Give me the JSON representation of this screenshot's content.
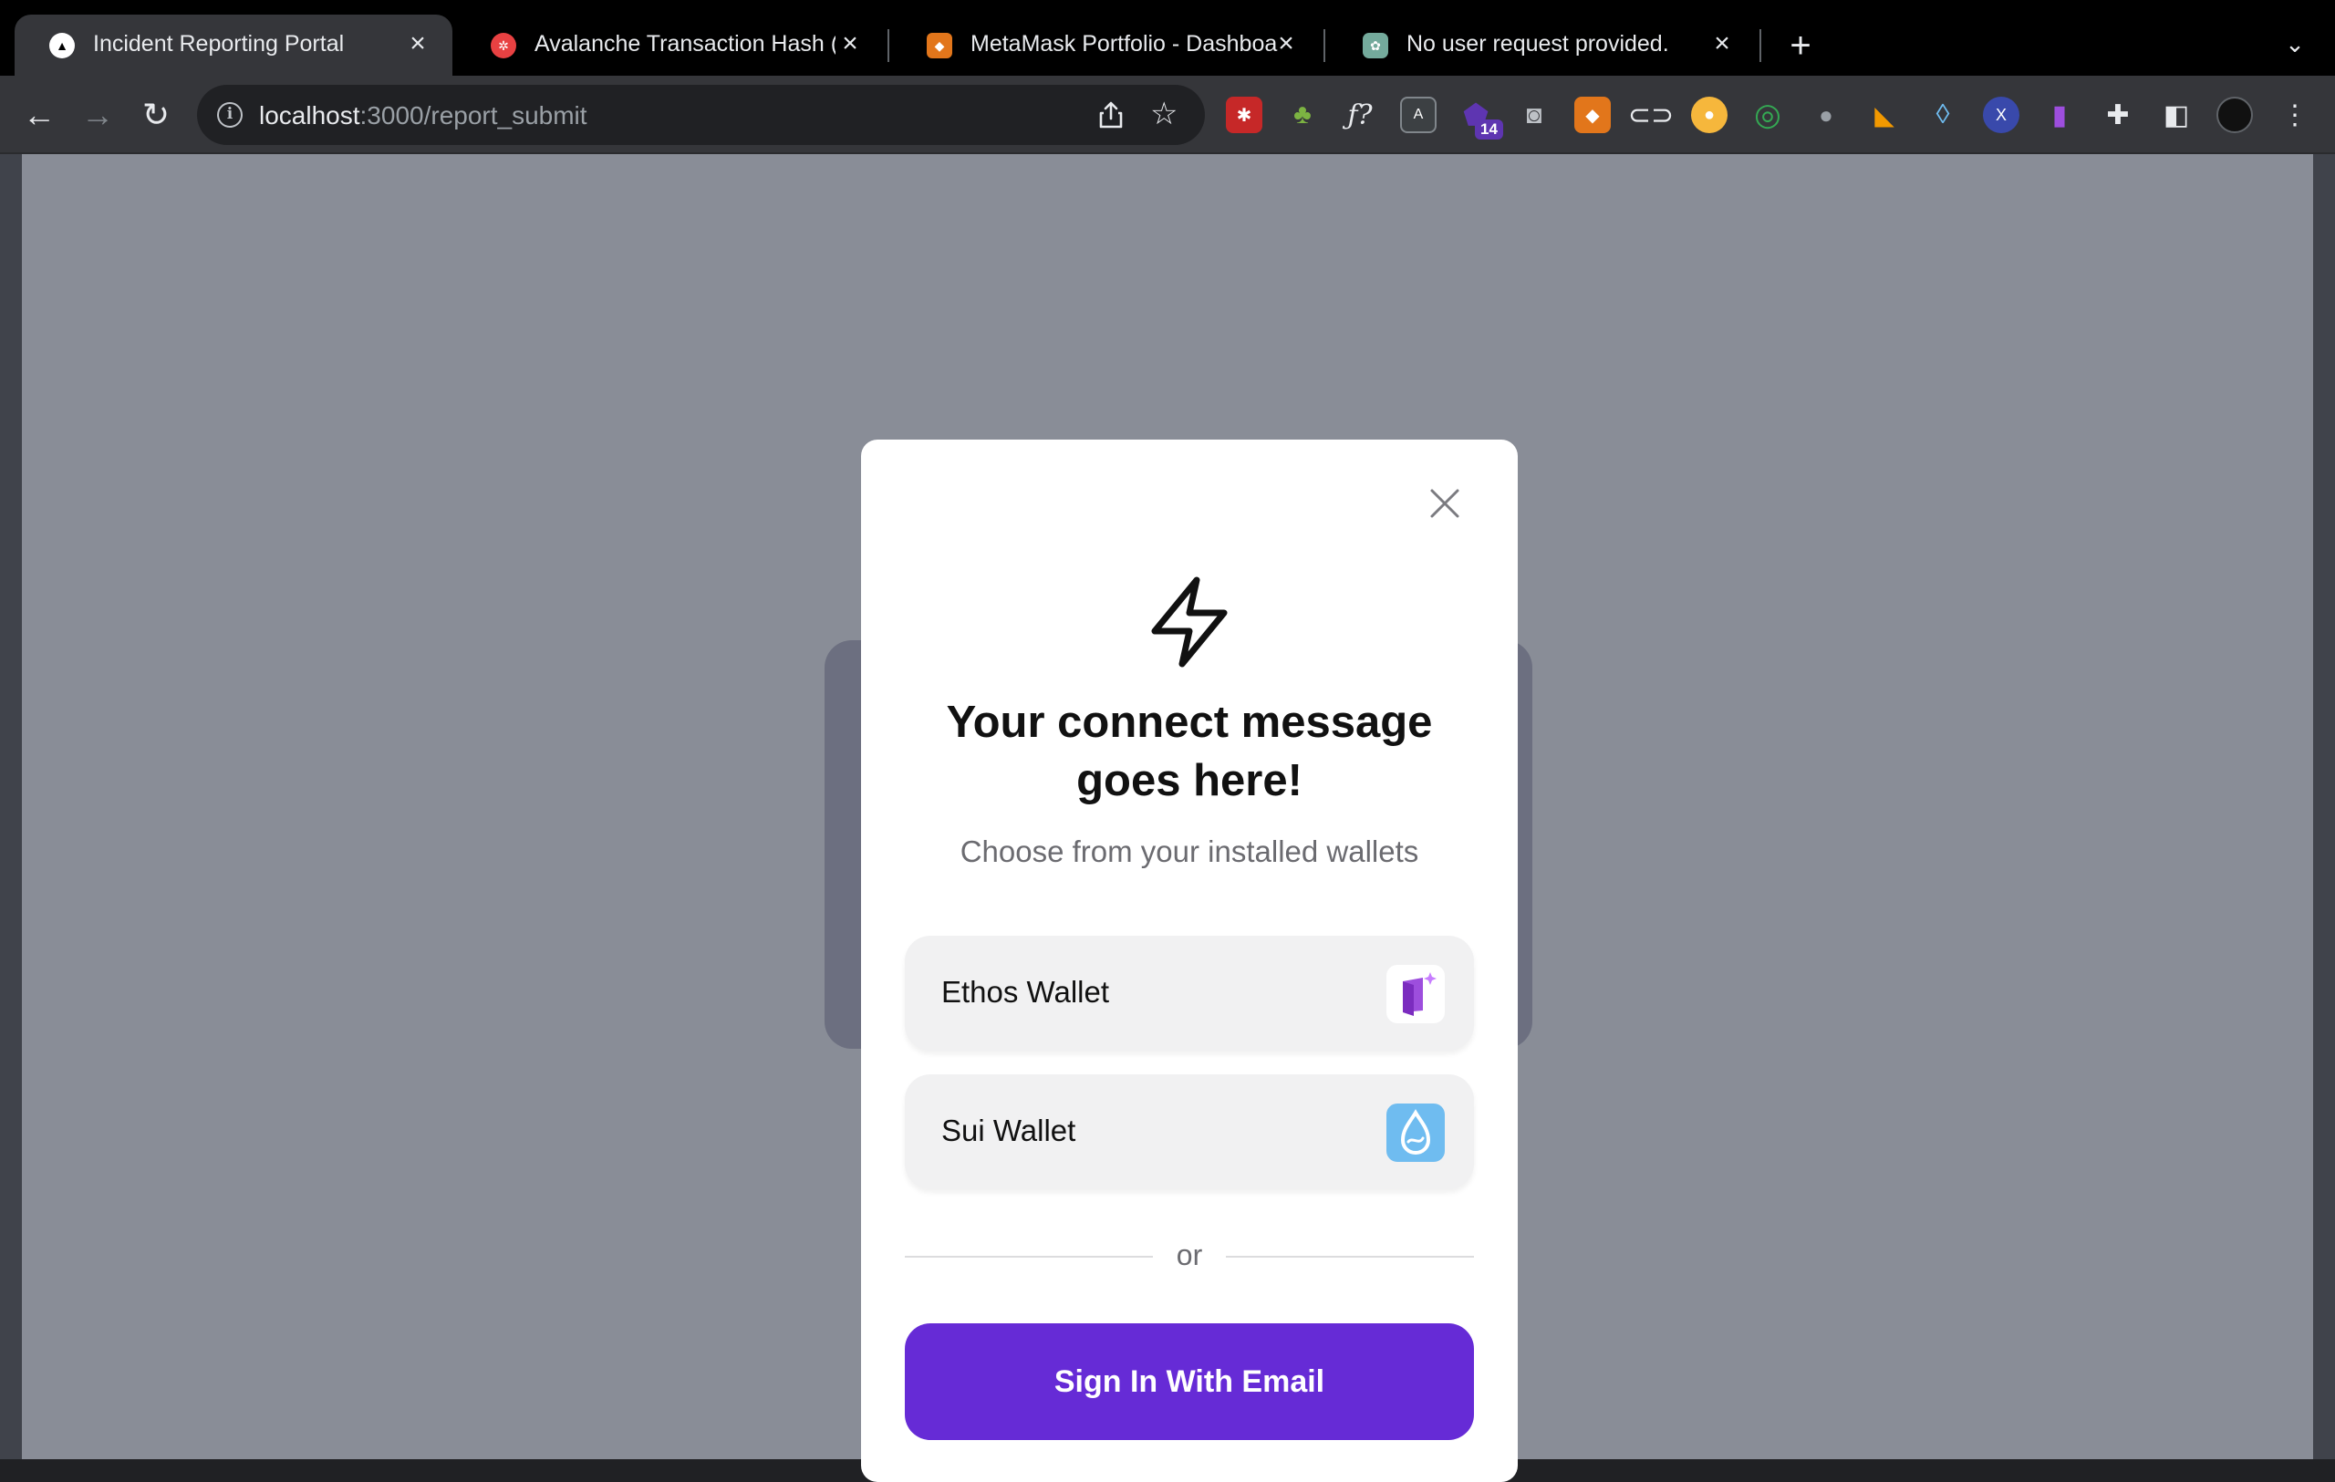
{
  "tabs": [
    {
      "title": "Incident Reporting Portal",
      "active": true,
      "favicon": "triangle-logo-icon"
    },
    {
      "title": "Avalanche Transaction Hash (T",
      "active": false,
      "favicon": "avalanche-icon"
    },
    {
      "title": "MetaMask Portfolio - Dashboa",
      "active": false,
      "favicon": "metamask-fox-icon"
    },
    {
      "title": "No user request provided.",
      "active": false,
      "favicon": "chatgpt-icon"
    }
  ],
  "omnibox": {
    "host": "localhost",
    "path": ":3000/report_submit"
  },
  "extensions": {
    "badge_count": "14"
  },
  "modal": {
    "title": "Your connect message goes here!",
    "subtitle": "Choose from your installed wallets",
    "wallets": [
      {
        "name": "Ethos Wallet",
        "icon": "ethos-wallet-icon"
      },
      {
        "name": "Sui Wallet",
        "icon": "sui-wallet-icon"
      }
    ],
    "divider_text": "or",
    "email_button": "Sign In With Email"
  },
  "colors": {
    "accent": "#662bd6",
    "overlay": "#898d97",
    "sui": "#6fbcf0",
    "ethos": "#9d4edd"
  }
}
